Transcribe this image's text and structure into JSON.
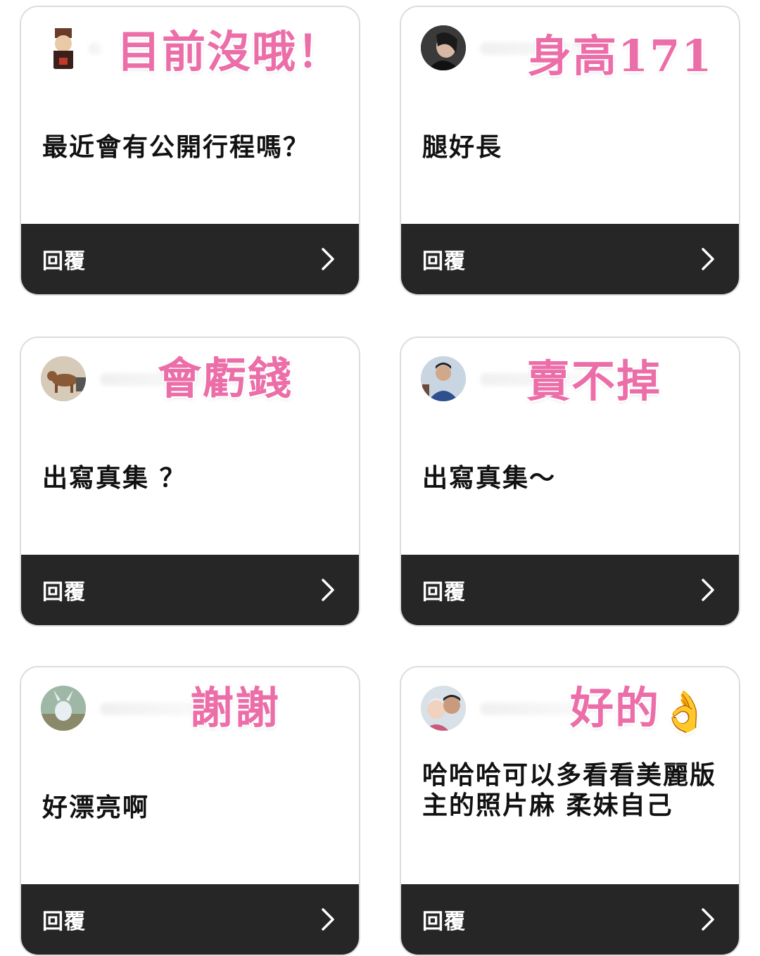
{
  "colors": {
    "sticker_pink": "#ec6ea9",
    "reply_bar": "#262626",
    "card_border": "#dcdcdc"
  },
  "cards": [
    {
      "sticker": "目前沒哦！",
      "question": "最近會有公開行程嗎？",
      "reply_label": "回覆",
      "icon": "chevron-right-icon"
    },
    {
      "sticker": "身高171",
      "question": "腿好長",
      "reply_label": "回覆",
      "icon": "chevron-right-icon"
    },
    {
      "sticker": "會虧錢",
      "question": "出寫真集 ？",
      "reply_label": "回覆",
      "icon": "chevron-right-icon"
    },
    {
      "sticker": "賣不掉",
      "question": "出寫真集～",
      "reply_label": "回覆",
      "icon": "chevron-right-icon"
    },
    {
      "sticker": "謝謝",
      "question": "好漂亮啊",
      "reply_label": "回覆",
      "icon": "chevron-right-icon"
    },
    {
      "sticker": "好的",
      "sticker_emoji": "👌",
      "question": "哈哈哈可以多看看美麗版主的照片麻 柔妹自己",
      "reply_label": "回覆",
      "icon": "chevron-right-icon"
    }
  ]
}
